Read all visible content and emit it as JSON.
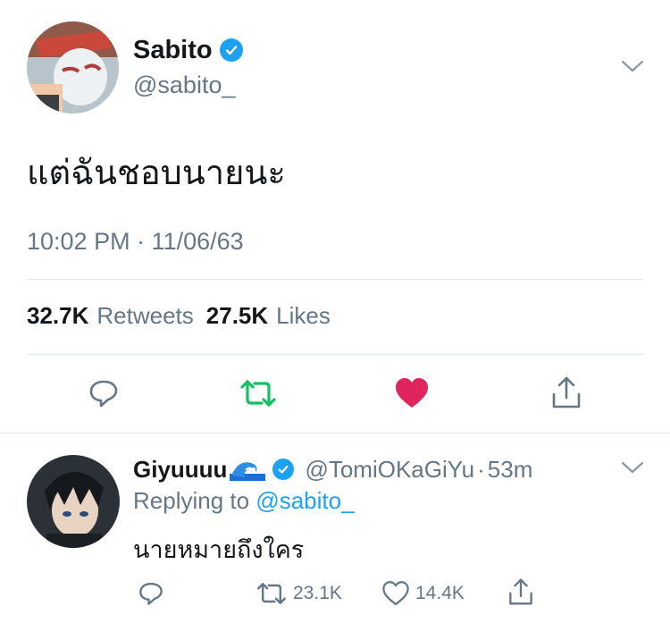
{
  "main_tweet": {
    "display_name": "Sabito",
    "handle": "@sabito_",
    "text": "แต่ฉันชอบนายนะ",
    "timestamp": "10:02 PM · 11/06/63",
    "retweets_count": "32.7K",
    "retweets_label": "Retweets",
    "likes_count": "27.5K",
    "likes_label": "Likes",
    "liked": true,
    "icons": [
      "reply-icon",
      "retweet-icon",
      "like-icon",
      "share-icon",
      "chevron-down-icon",
      "verified-badge-icon"
    ]
  },
  "reply_tweet": {
    "display_name": "Giyuuuu",
    "handle": "@TomiOKaGiYu",
    "separator": "·",
    "time_ago": "53m",
    "replying_prefix": "Replying to",
    "replying_to": "@sabito_",
    "text": "นายหมายถึงใคร",
    "retweets_count": "23.1K",
    "likes_count": "14.4K",
    "icons": [
      "reply-icon",
      "retweet-icon",
      "like-icon",
      "share-icon",
      "chevron-down-icon",
      "verified-badge-icon",
      "wave-emoji"
    ]
  },
  "colors": {
    "accent_blue": "#1da1f2",
    "retweet_green": "#17bf63",
    "like_red": "#e0245e",
    "muted": "#657786",
    "text": "#14171a",
    "divider": "#e1e8ed"
  }
}
